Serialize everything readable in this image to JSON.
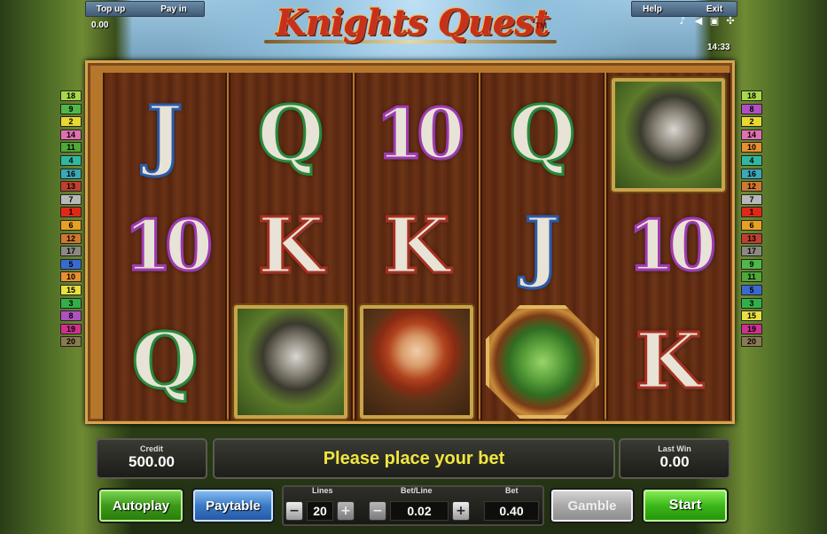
{
  "topbar": {
    "top_up": "Top up",
    "pay_in": "Pay in",
    "balance": "0.00",
    "help": "Help",
    "exit": "Exit",
    "clock": "14:33",
    "icons": [
      "music-icon",
      "sound-icon",
      "settings-icon",
      "fullscreen-icon"
    ]
  },
  "title": {
    "logo": "Knights Quest",
    "tm": "TM"
  },
  "reels": [
    {
      "symbols": [
        {
          "type": "letter",
          "value": "J",
          "edge": "#2e5aa8",
          "name": "symbol-j"
        },
        {
          "type": "ten",
          "value": "10",
          "edge": "#a03ab0",
          "name": "symbol-10"
        },
        {
          "type": "letter",
          "value": "Q",
          "edge": "#2a8a3a",
          "name": "symbol-q"
        }
      ]
    },
    {
      "symbols": [
        {
          "type": "letter",
          "value": "Q",
          "edge": "#2a8a3a",
          "name": "symbol-q"
        },
        {
          "type": "letter",
          "value": "K",
          "edge": "#a83020",
          "name": "symbol-k"
        },
        {
          "type": "pic",
          "value": "horse",
          "name": "symbol-horse"
        }
      ]
    },
    {
      "symbols": [
        {
          "type": "ten",
          "value": "10",
          "edge": "#a03ab0",
          "name": "symbol-10"
        },
        {
          "type": "letter",
          "value": "K",
          "edge": "#a83020",
          "name": "symbol-k"
        },
        {
          "type": "pic",
          "value": "lady",
          "name": "symbol-lady"
        }
      ]
    },
    {
      "symbols": [
        {
          "type": "letter",
          "value": "Q",
          "edge": "#2a8a3a",
          "name": "symbol-q"
        },
        {
          "type": "letter",
          "value": "J",
          "edge": "#2e5aa8",
          "name": "symbol-j"
        },
        {
          "type": "pic",
          "value": "dragon",
          "name": "symbol-dragon"
        }
      ]
    },
    {
      "symbols": [
        {
          "type": "pic",
          "value": "horse",
          "name": "symbol-horse"
        },
        {
          "type": "ten",
          "value": "10",
          "edge": "#a03ab0",
          "name": "symbol-10"
        },
        {
          "type": "letter",
          "value": "K",
          "edge": "#a83020",
          "name": "symbol-k"
        }
      ]
    }
  ],
  "lines_left": [
    {
      "n": "18",
      "color": "#a8d84a"
    },
    {
      "n": "9",
      "color": "#4fb848"
    },
    {
      "n": "2",
      "color": "#e8d830"
    },
    {
      "n": "14",
      "color": "#e070b0"
    },
    {
      "n": "11",
      "color": "#4fa838"
    },
    {
      "n": "4",
      "color": "#2fb8a0"
    },
    {
      "n": "16",
      "color": "#3aa8b8"
    },
    {
      "n": "13",
      "color": "#c04030"
    },
    {
      "n": "7",
      "color": "#b8b8b8"
    },
    {
      "n": "1",
      "color": "#e02818"
    },
    {
      "n": "6",
      "color": "#e8a020"
    },
    {
      "n": "12",
      "color": "#d07830"
    },
    {
      "n": "17",
      "color": "#8a8a80"
    },
    {
      "n": "5",
      "color": "#3a6ad0"
    },
    {
      "n": "10",
      "color": "#e89030"
    },
    {
      "n": "15",
      "color": "#e8e040"
    },
    {
      "n": "3",
      "color": "#30b048"
    },
    {
      "n": "8",
      "color": "#b050c0"
    },
    {
      "n": "19",
      "color": "#d03090"
    },
    {
      "n": "20",
      "color": "#8a7a50"
    }
  ],
  "lines_right": [
    {
      "n": "18",
      "color": "#a8d84a"
    },
    {
      "n": "8",
      "color": "#b050c0"
    },
    {
      "n": "2",
      "color": "#e8d830"
    },
    {
      "n": "14",
      "color": "#e070b0"
    },
    {
      "n": "10",
      "color": "#e89030"
    },
    {
      "n": "4",
      "color": "#2fb8a0"
    },
    {
      "n": "16",
      "color": "#3aa8b8"
    },
    {
      "n": "12",
      "color": "#d07830"
    },
    {
      "n": "7",
      "color": "#b8b8b8"
    },
    {
      "n": "1",
      "color": "#e02818"
    },
    {
      "n": "6",
      "color": "#e8a020"
    },
    {
      "n": "13",
      "color": "#c04030"
    },
    {
      "n": "17",
      "color": "#8a8a80"
    },
    {
      "n": "9",
      "color": "#4fb848"
    },
    {
      "n": "11",
      "color": "#4fa838"
    },
    {
      "n": "5",
      "color": "#3a6ad0"
    },
    {
      "n": "3",
      "color": "#30b048"
    },
    {
      "n": "15",
      "color": "#e8e040"
    },
    {
      "n": "19",
      "color": "#d03090"
    },
    {
      "n": "20",
      "color": "#8a7a50"
    }
  ],
  "hud": {
    "credit_label": "Credit",
    "credit_value": "500.00",
    "message": "Please place your bet",
    "last_win_label": "Last Win",
    "last_win_value": "0.00"
  },
  "controls": {
    "autoplay": "Autoplay",
    "paytable": "Paytable",
    "lines_label": "Lines",
    "lines_value": "20",
    "betline_label": "Bet/Line",
    "betline_value": "0.02",
    "bet_label": "Bet",
    "bet_value": "0.40",
    "minus": "−",
    "plus": "+",
    "gamble": "Gamble",
    "start": "Start"
  }
}
